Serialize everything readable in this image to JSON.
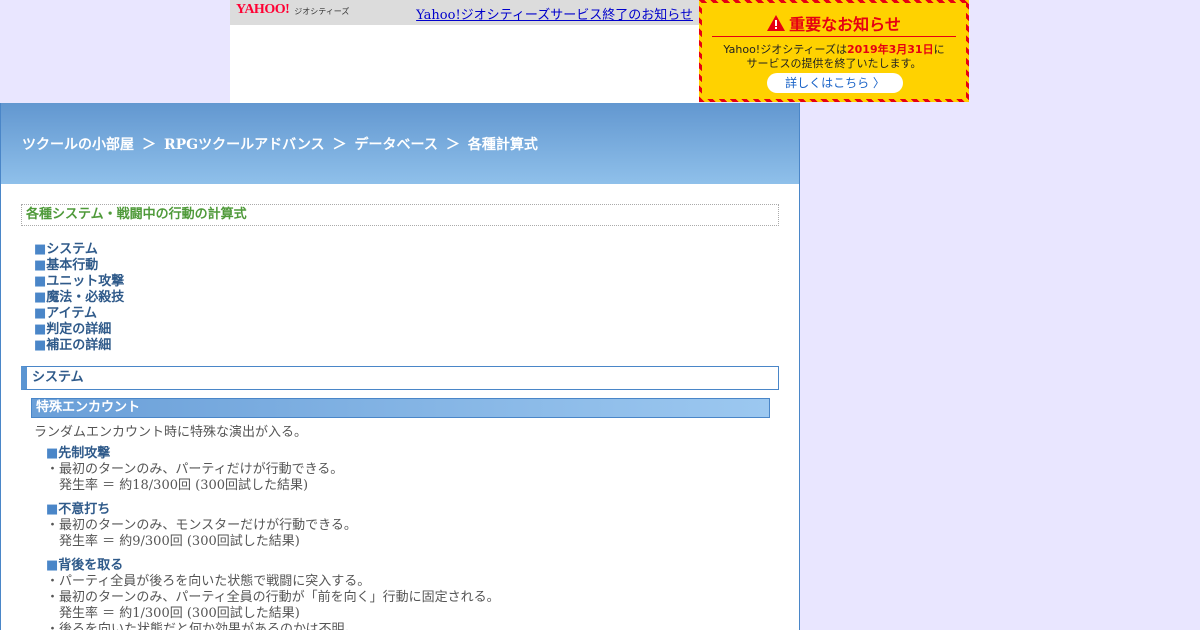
{
  "yahoo_bar": {
    "logo_text": "YAHOO!",
    "logo_sub": "JAPAN",
    "geo_text": "ジオシティーズ",
    "notice_link": "Yahoo!ジオシティーズサービス終了のお知らせ"
  },
  "notice_box": {
    "title": "重要なお知らせ",
    "line1_pre": "Yahoo!ジオシティーズは",
    "line1_date": "2019年3月31日",
    "line1_post": "に",
    "line2": "サービスの提供を終了いたします。",
    "button": "詳しくはこちら 〉",
    "colors": {
      "accent": "#e60012",
      "background": "#ffd200",
      "link": "#1a63c7"
    }
  },
  "breadcrumb": {
    "items": [
      "ツクールの小部屋",
      "RPGツクールアドバンス",
      "データベース",
      "各種計算式"
    ],
    "separator": "＞"
  },
  "section_title": "各種システム・戦闘中の行動の計算式",
  "toc": {
    "mark": "■",
    "items": [
      "システム",
      "基本行動",
      "ユニット攻撃",
      "魔法・必殺技",
      "アイテム",
      "判定の詳細",
      "補正の詳細"
    ]
  },
  "system_heading": "システム",
  "sub_heading": "特殊エンカウント",
  "intro": "ランダムエンカウント時に特殊な演出が入る。",
  "entries": [
    {
      "title": "先制攻撃",
      "lines": [
        "・最初のターンのみ、パーティだけが行動できる。"
      ],
      "rate": "発生率 ＝ 約18/300回 (300回試した結果)"
    },
    {
      "title": "不意打ち",
      "lines": [
        "・最初のターンのみ、モンスターだけが行動できる。"
      ],
      "rate": "発生率 ＝ 約9/300回 (300回試した結果)"
    },
    {
      "title": "背後を取る",
      "lines": [
        "・パーティ全員が後ろを向いた状態で戦闘に突入する。",
        "・最初のターンのみ、パーティ全員の行動が「前を向く」行動に固定される。"
      ],
      "rate": "発生率 ＝ 約1/300回 (300回試した結果)",
      "extra": "・後ろを向いた状態だと何か効果があるのかは不明。"
    }
  ]
}
